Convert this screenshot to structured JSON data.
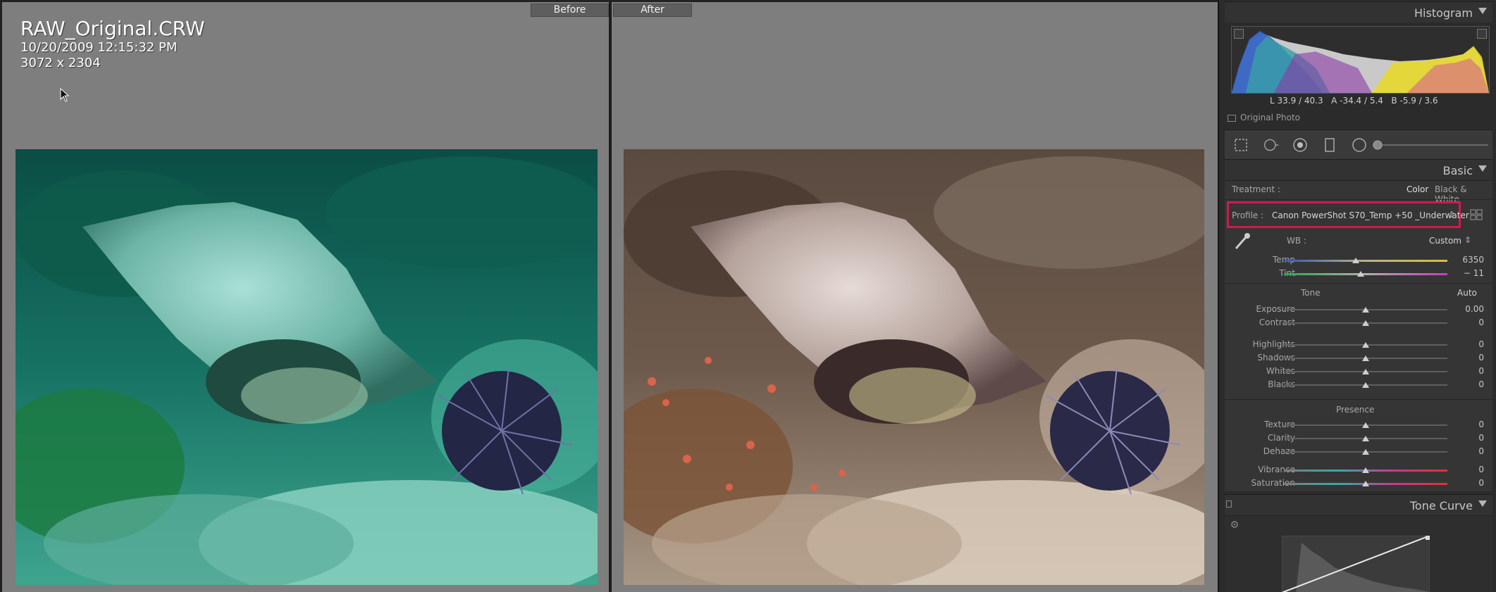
{
  "compare": {
    "before_label": "Before",
    "after_label": "After",
    "file_name": "RAW_Original.CRW",
    "date_time": "10/20/2009 12:15:32 PM",
    "dimensions": "3072 x 2304"
  },
  "histogram": {
    "title": "Histogram",
    "lab_L_label": "L",
    "lab_L_value": "33.9 / 40.3",
    "lab_A_label": "A",
    "lab_A_value": "-34.4 /  5.4",
    "lab_B_label": "B",
    "lab_B_value": "-5.9 /  3.6",
    "original_photo_label": "Original Photo"
  },
  "basic": {
    "title": "Basic",
    "treatment_label": "Treatment :",
    "treatment_color": "Color",
    "treatment_bw": "Black & White",
    "profile_label": "Profile :",
    "profile_value": "Canon PowerShot S70_Temp +50 _Underwater",
    "wb_label": "WB :",
    "wb_value": "Custom",
    "sliders_wb": [
      {
        "label": "Temp",
        "value": "6350",
        "position": 0.44
      },
      {
        "label": "Tint",
        "value": "− 11",
        "position": 0.47
      }
    ],
    "tone_label": "Tone",
    "auto_label": "Auto",
    "sliders_tone": [
      {
        "label": "Exposure",
        "value": "0.00",
        "position": 0.5
      },
      {
        "label": "Contrast",
        "value": "0",
        "position": 0.5
      }
    ],
    "sliders_tone2": [
      {
        "label": "Highlights",
        "value": "0",
        "position": 0.5
      },
      {
        "label": "Shadows",
        "value": "0",
        "position": 0.5
      },
      {
        "label": "Whites",
        "value": "0",
        "position": 0.5
      },
      {
        "label": "Blacks",
        "value": "0",
        "position": 0.5
      }
    ],
    "presence_label": "Presence",
    "sliders_presence": [
      {
        "label": "Texture",
        "value": "0",
        "position": 0.5
      },
      {
        "label": "Clarity",
        "value": "0",
        "position": 0.5
      },
      {
        "label": "Dehaze",
        "value": "0",
        "position": 0.5
      }
    ],
    "sliders_presence2": [
      {
        "label": "Vibrance",
        "value": "0",
        "position": 0.5
      },
      {
        "label": "Saturation",
        "value": "0",
        "position": 0.5
      }
    ]
  },
  "tone_curve": {
    "title": "Tone Curve"
  },
  "colors": {
    "highlight_box": "#d6184c",
    "panel_bg": "#2b2b2b",
    "view_bg": "#7e7e7e"
  },
  "icons": [
    "cursor-arrow-icon",
    "crop-tool-icon",
    "spot-removal-icon",
    "red-eye-icon",
    "graduated-filter-icon",
    "radial-filter-icon",
    "adjustment-brush-icon",
    "eyedropper-icon",
    "profile-browser-icon",
    "panel-collapse-icon",
    "target-adjust-icon"
  ]
}
